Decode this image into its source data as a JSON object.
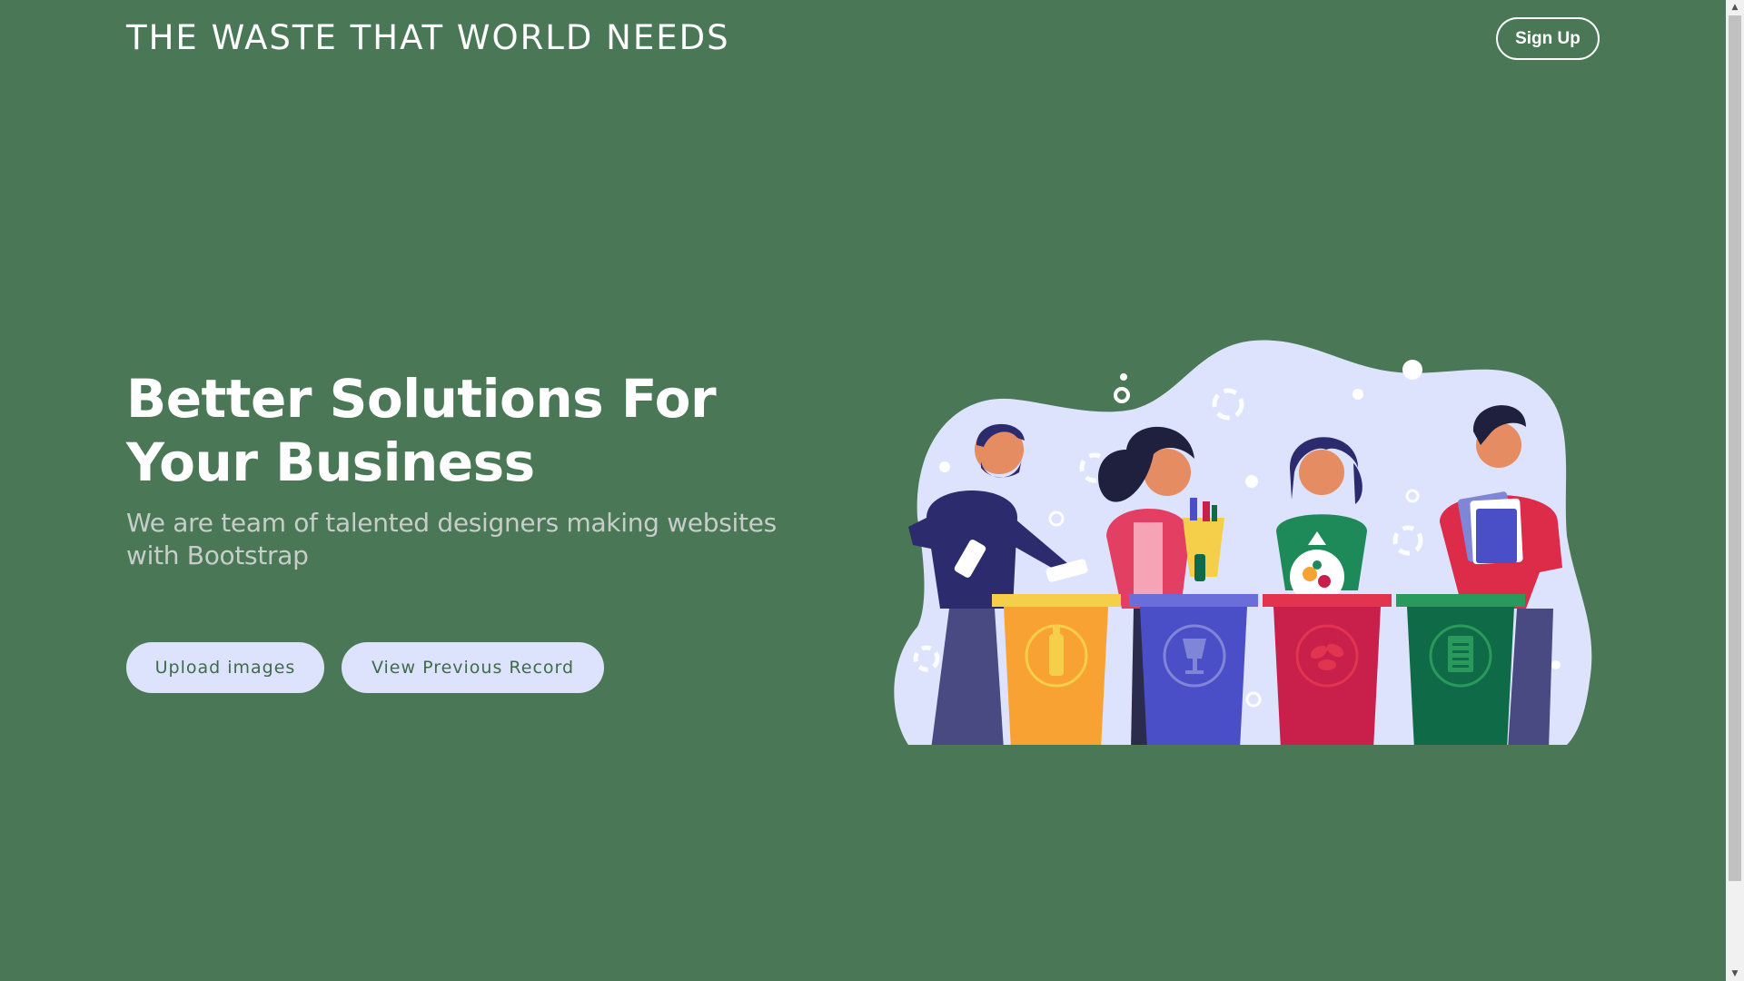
{
  "header": {
    "brand": "THE WASTE THAT WORLD NEEDS",
    "signup_label": "Sign Up"
  },
  "hero": {
    "title": "Better Solutions For Your Business",
    "subtitle": "We are team of talented designers making websites with Bootstrap",
    "upload_label": "Upload images",
    "view_label": "View Previous Record"
  },
  "colors": {
    "background": "#4a7856",
    "button_bg": "#dde3fc",
    "button_text": "#3e6b4c",
    "blob": "#dde3fc",
    "bin_yellow": "#f8a233",
    "bin_blue": "#4b4fc7",
    "bin_red": "#c9204b",
    "bin_green": "#0f6b47"
  },
  "illustration": {
    "icons": [
      "bottle-icon",
      "glass-icon",
      "leaf-icon",
      "paper-icon",
      "recycle-icon"
    ]
  }
}
